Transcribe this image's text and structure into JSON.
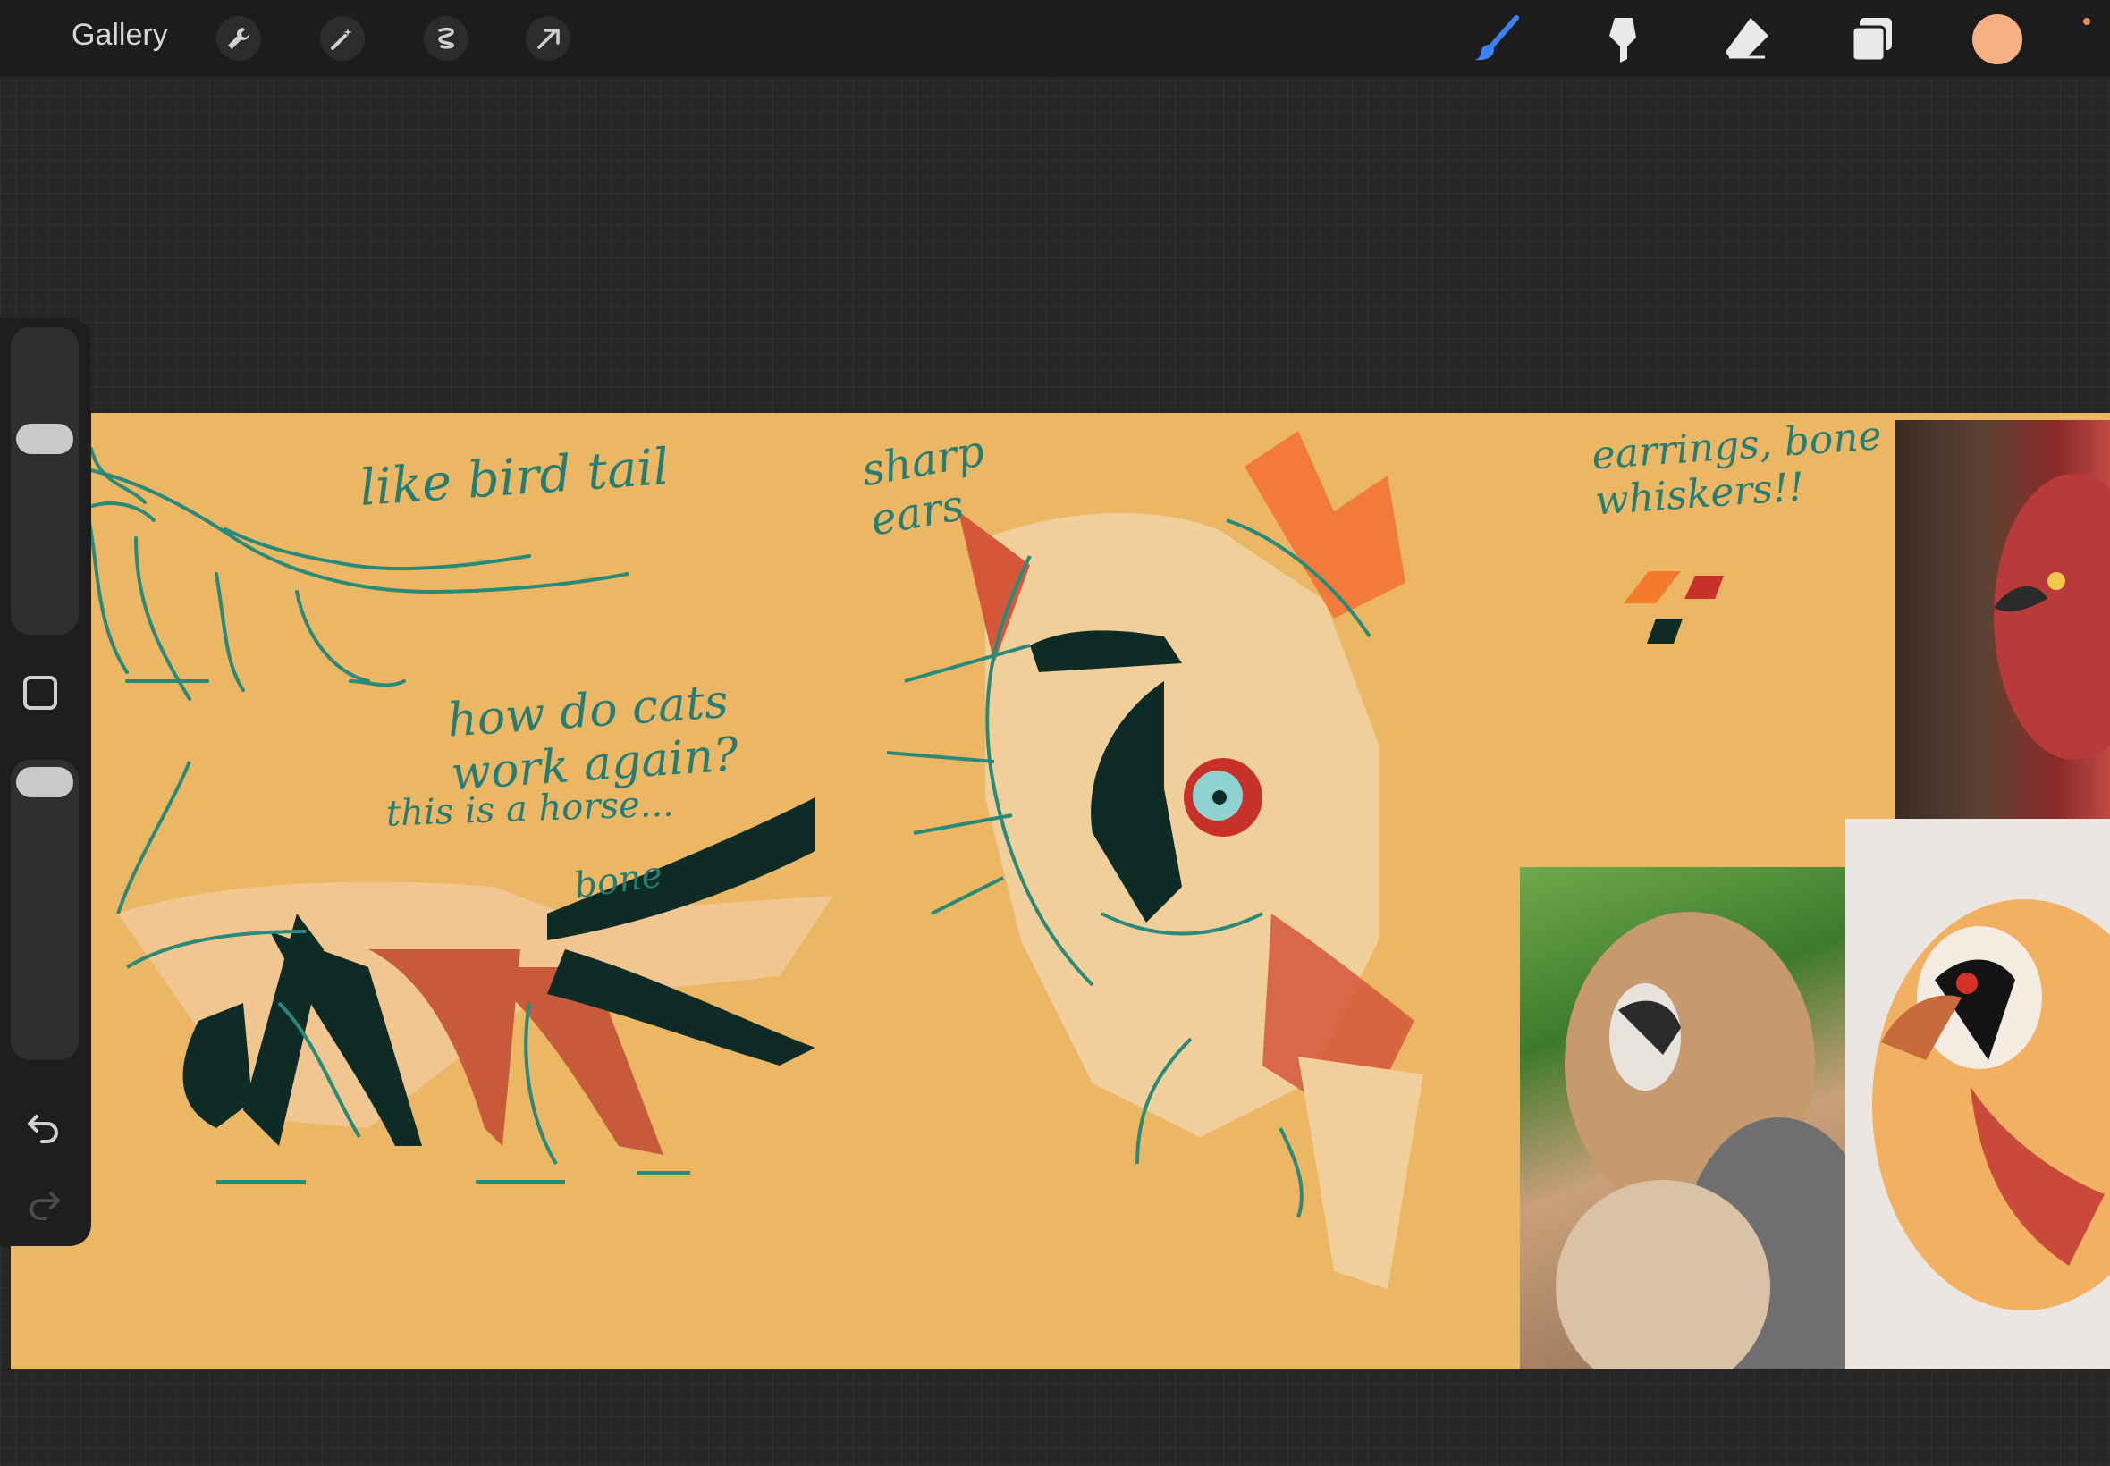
{
  "toolbar": {
    "gallery_label": "Gallery",
    "left_tools": [
      "wrench-icon",
      "magic-wand-icon",
      "selection-icon",
      "transform-arrow-icon"
    ],
    "right_tools": [
      "brush-icon",
      "smudge-icon",
      "eraser-icon",
      "layers-icon"
    ],
    "active_tool": "brush-icon",
    "active_color": "#f7b084",
    "brush_icon_color": "#3b82f6"
  },
  "sidebar": {
    "brush_size_slider": "size",
    "opacity_slider": "opacity",
    "modify_button_icon": "square-icon",
    "undo_icon": "undo-icon",
    "redo_icon": "redo-icon"
  },
  "canvas": {
    "background_color": "#ecb764",
    "notes": {
      "bird_tail": "like bird tail",
      "cats": "how do cats work again?",
      "horse": "this is a horse...",
      "bone": "bone",
      "ears": "sharp ears",
      "earrings": "earrings, bone whiskers!!"
    },
    "palette_colors": [
      "#f47a2c",
      "#c8312a",
      "#0f2b26"
    ]
  }
}
